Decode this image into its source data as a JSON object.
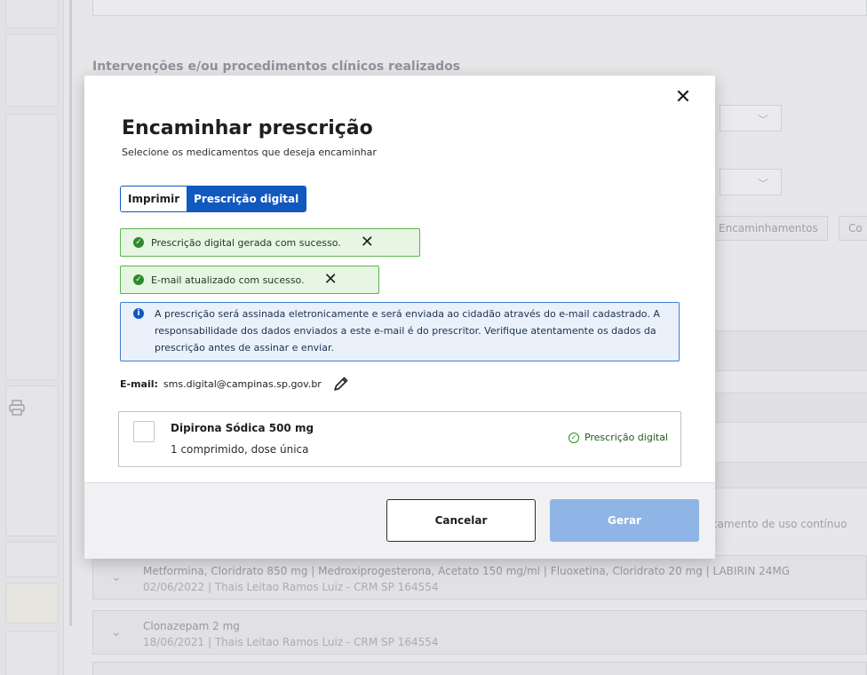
{
  "background": {
    "section_title": "Intervenções e/ou procedimentos clínicos realizados",
    "tabs": [
      "Encaminhamentos",
      "Co"
    ],
    "continuous_use_label": "dicamento de uso contínuo",
    "rows": [
      {
        "title": "Metformina, Cloridrato 850 mg | Medroxiprogesterona, Acetato 150 mg/ml | Fluoxetina, Cloridrato 20 mg | LABIRIN 24MG",
        "subtitle": "02/06/2022 | Thais Leitao Ramos Luiz - CRM SP 164554"
      },
      {
        "title": "Clonazepam 2 mg",
        "subtitle": "18/06/2021 | Thais Leitao Ramos Luiz - CRM SP 164554"
      }
    ]
  },
  "modal": {
    "title": "Encaminhar prescrição",
    "subtitle": "Selecione os medicamentos que deseja encaminhar",
    "toggle": {
      "print_label": "Imprimir",
      "digital_label": "Prescrição digital",
      "selected": "Prescrição digital"
    },
    "alerts": {
      "success_1": "Prescrição digital gerada com sucesso.",
      "success_2": "E-mail atualizado com sucesso.",
      "info": "A prescrição será assinada eletronicamente e será enviada ao cidadão através do e-mail cadastrado. A responsabilidade dos dados enviados a este e-mail é do prescritor. Verifique atentamente os dados da prescrição antes de assinar e enviar."
    },
    "email": {
      "label": "E-mail:",
      "value": "sms.digital@campinas.sp.gov.br"
    },
    "medications": [
      {
        "name": "Dipirona Sódica 500 mg",
        "dose": "1 comprimido, dose única",
        "status": "Prescrição digital",
        "checked": false
      }
    ],
    "buttons": {
      "cancel": "Cancelar",
      "generate": "Gerar"
    }
  },
  "colors": {
    "primary": "#1158bf",
    "success_border": "#58b34b",
    "success_bg": "#e7f6e3",
    "info_border": "#3f7fd6",
    "info_bg": "#eaf1fb",
    "disabled_button": "#8fb5e6"
  },
  "icons": {
    "close": "close-icon",
    "check_circle": "check-circle-icon",
    "info": "info-icon",
    "edit": "pencil-icon",
    "print": "printer-icon",
    "chevron": "chevron-down-icon"
  }
}
